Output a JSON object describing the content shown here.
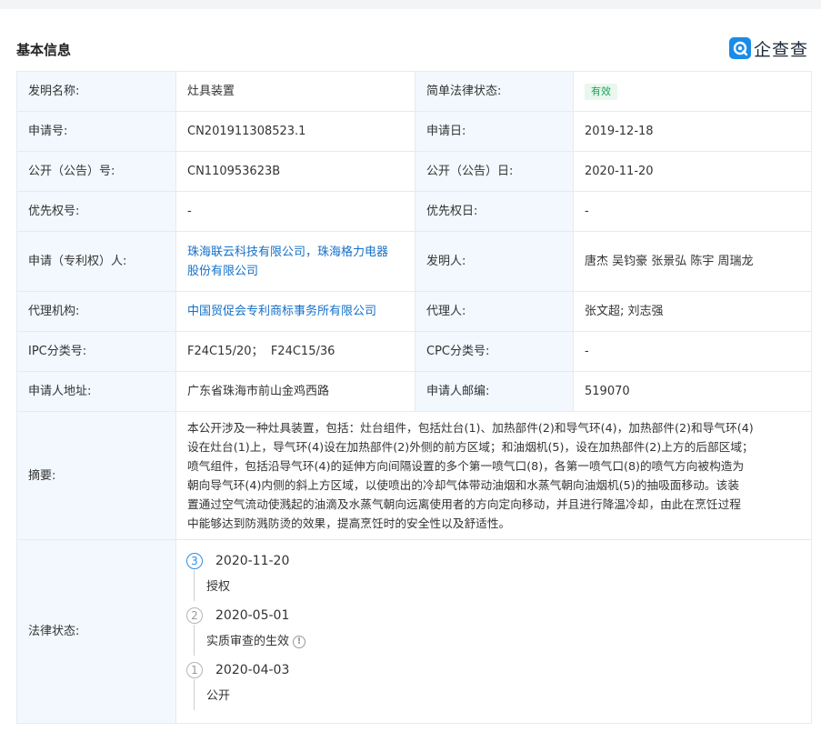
{
  "header": {
    "title": "基本信息",
    "logo_text": "企查查"
  },
  "fields": {
    "invention_name": {
      "label": "发明名称:",
      "value": "灶具装置"
    },
    "legal_status_simple": {
      "label": "简单法律状态:",
      "value": "有效"
    },
    "application_no": {
      "label": "申请号:",
      "value": "CN201911308523.1"
    },
    "application_date": {
      "label": "申请日:",
      "value": "2019-12-18"
    },
    "publication_no": {
      "label": "公开（公告）号:",
      "value": "CN110953623B"
    },
    "publication_date": {
      "label": "公开（公告）日:",
      "value": "2020-11-20"
    },
    "priority_no": {
      "label": "优先权号:",
      "value": "-"
    },
    "priority_date": {
      "label": "优先权日:",
      "value": "-"
    },
    "applicant": {
      "label": "申请（专利权）人:",
      "line1": "珠海联云科技有限公司，珠海格力电器",
      "line2": "股份有限公司"
    },
    "inventor": {
      "label": "发明人:",
      "value": "唐杰 吴钧豪 张景弘 陈宇 周瑞龙"
    },
    "agency": {
      "label": "代理机构:",
      "value": "中国贸促会专利商标事务所有限公司"
    },
    "agent": {
      "label": "代理人:",
      "value": "张文超; 刘志强"
    },
    "ipc": {
      "label": "IPC分类号:",
      "value": "F24C15/20；  F24C15/36"
    },
    "cpc": {
      "label": "CPC分类号:",
      "value": "-"
    },
    "address": {
      "label": "申请人地址:",
      "value": "广东省珠海市前山金鸡西路"
    },
    "postcode": {
      "label": "申请人邮编:",
      "value": "519070"
    },
    "abstract": {
      "label": "摘要:",
      "lines": [
        "本公开涉及一种灶具装置，包括：灶台组件，包括灶台(1)、加热部件(2)和导气环(4)，加热部件(2)和导气环(4)",
        "设在灶台(1)上，导气环(4)设在加热部件(2)外侧的前方区域；和油烟机(5)，设在加热部件(2)上方的后部区域；",
        "喷气组件，包括沿导气环(4)的延伸方向间隔设置的多个第一喷气口(8)，各第一喷气口(8)的喷气方向被构造为",
        "朝向导气环(4)内侧的斜上方区域，以使喷出的冷却气体带动油烟和水蒸气朝向油烟机(5)的抽吸面移动。该装",
        "置通过空气流动使溅起的油滴及水蒸气朝向远离使用者的方向定向移动，并且进行降温冷却，由此在烹饪过程",
        "中能够达到防溅防烫的效果，提高烹饪时的安全性以及舒适性。"
      ]
    },
    "legal_status": {
      "label": "法律状态:",
      "events": [
        {
          "step": "3",
          "date": "2020-11-20",
          "desc": "授权"
        },
        {
          "step": "2",
          "date": "2020-05-01",
          "desc": "实质审查的生效"
        },
        {
          "step": "1",
          "date": "2020-04-03",
          "desc": "公开"
        }
      ]
    }
  },
  "colors": {
    "label_bg": "#f2f8fe",
    "link": "#1470c8",
    "badge_bg": "#e9f7ee",
    "badge_text": "#1aa05a",
    "timeline_active": "#2c8de8",
    "logo_accent": "#1a8ce8"
  },
  "icons": {
    "logo": "qichacha-logo-icon",
    "info": "exclamation-circle-icon"
  }
}
